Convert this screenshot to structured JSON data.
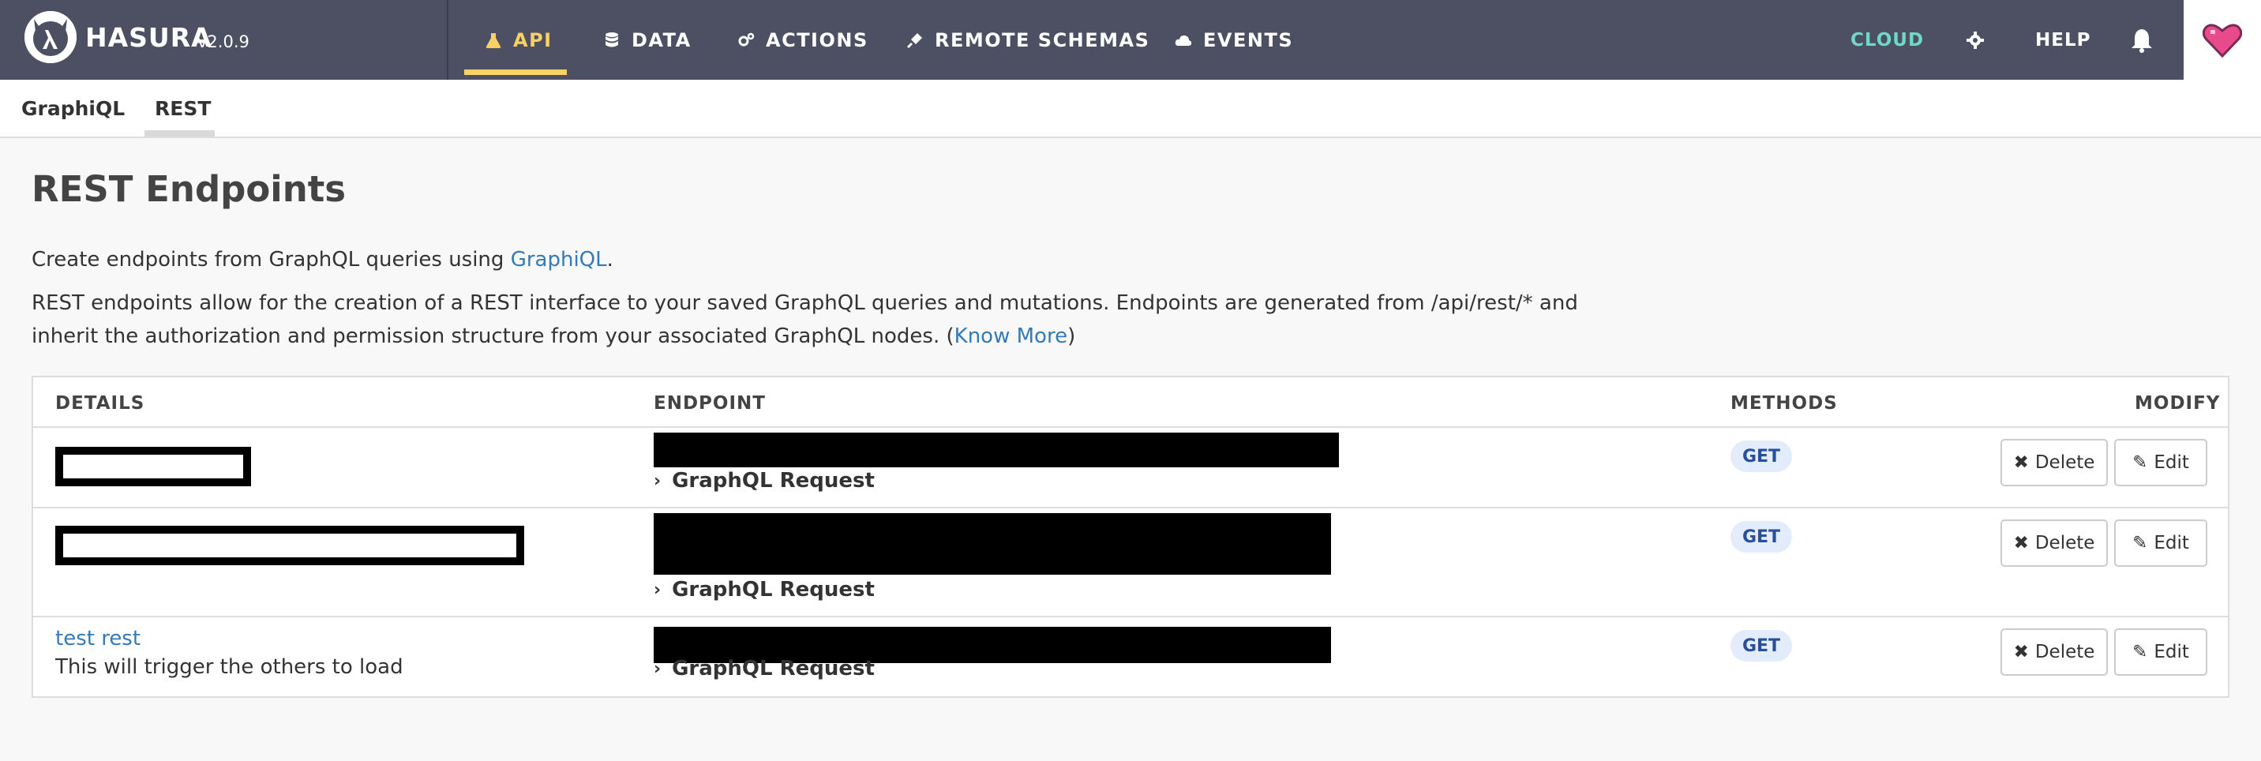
{
  "brand": {
    "name": "HASURA",
    "version": "v2.0.9"
  },
  "nav": {
    "items": [
      {
        "label": "API",
        "icon": "flask-icon",
        "active": true
      },
      {
        "label": "DATA",
        "icon": "database-icon"
      },
      {
        "label": "ACTIONS",
        "icon": "cogs-icon"
      },
      {
        "label": "REMOTE SCHEMAS",
        "icon": "plug-icon"
      },
      {
        "label": "EVENTS",
        "icon": "cloud-icon"
      }
    ],
    "cloud": "CLOUD",
    "help": "HELP"
  },
  "subnav": {
    "tabs": [
      {
        "label": "GraphiQL"
      },
      {
        "label": "REST",
        "active": true
      }
    ]
  },
  "main": {
    "title": "REST Endpoints",
    "intro_prefix": "Create endpoints from GraphQL queries using ",
    "intro_link": "GraphiQL",
    "intro_suffix": ".",
    "desc_line1": "REST endpoints allow for the creation of a REST interface to your saved GraphQL queries and mutations. Endpoints are generated from /api/rest/* and",
    "desc_line2_prefix": "inherit the authorization and permission structure from your associated GraphQL nodes. (",
    "desc_link": "Know More",
    "desc_suffix": ")"
  },
  "table": {
    "headers": {
      "details": "DETAILS",
      "endpoint": "ENDPOINT",
      "methods": "METHODS",
      "modify": "MODIFY"
    },
    "gql_label": "GraphQL Request",
    "delete_label": "Delete",
    "edit_label": "Edit",
    "rows": [
      {
        "name": "",
        "description": "",
        "method": "GET"
      },
      {
        "name": "",
        "description": "",
        "method": "GET"
      },
      {
        "name": "test rest",
        "description": "This will trigger the others to load",
        "method": "GET"
      }
    ]
  },
  "colors": {
    "topbar": "#4d5063",
    "accent": "#f8d166",
    "cloud": "#6ed9c5",
    "link": "#337ab7",
    "badge_bg": "#e2ecfb"
  }
}
